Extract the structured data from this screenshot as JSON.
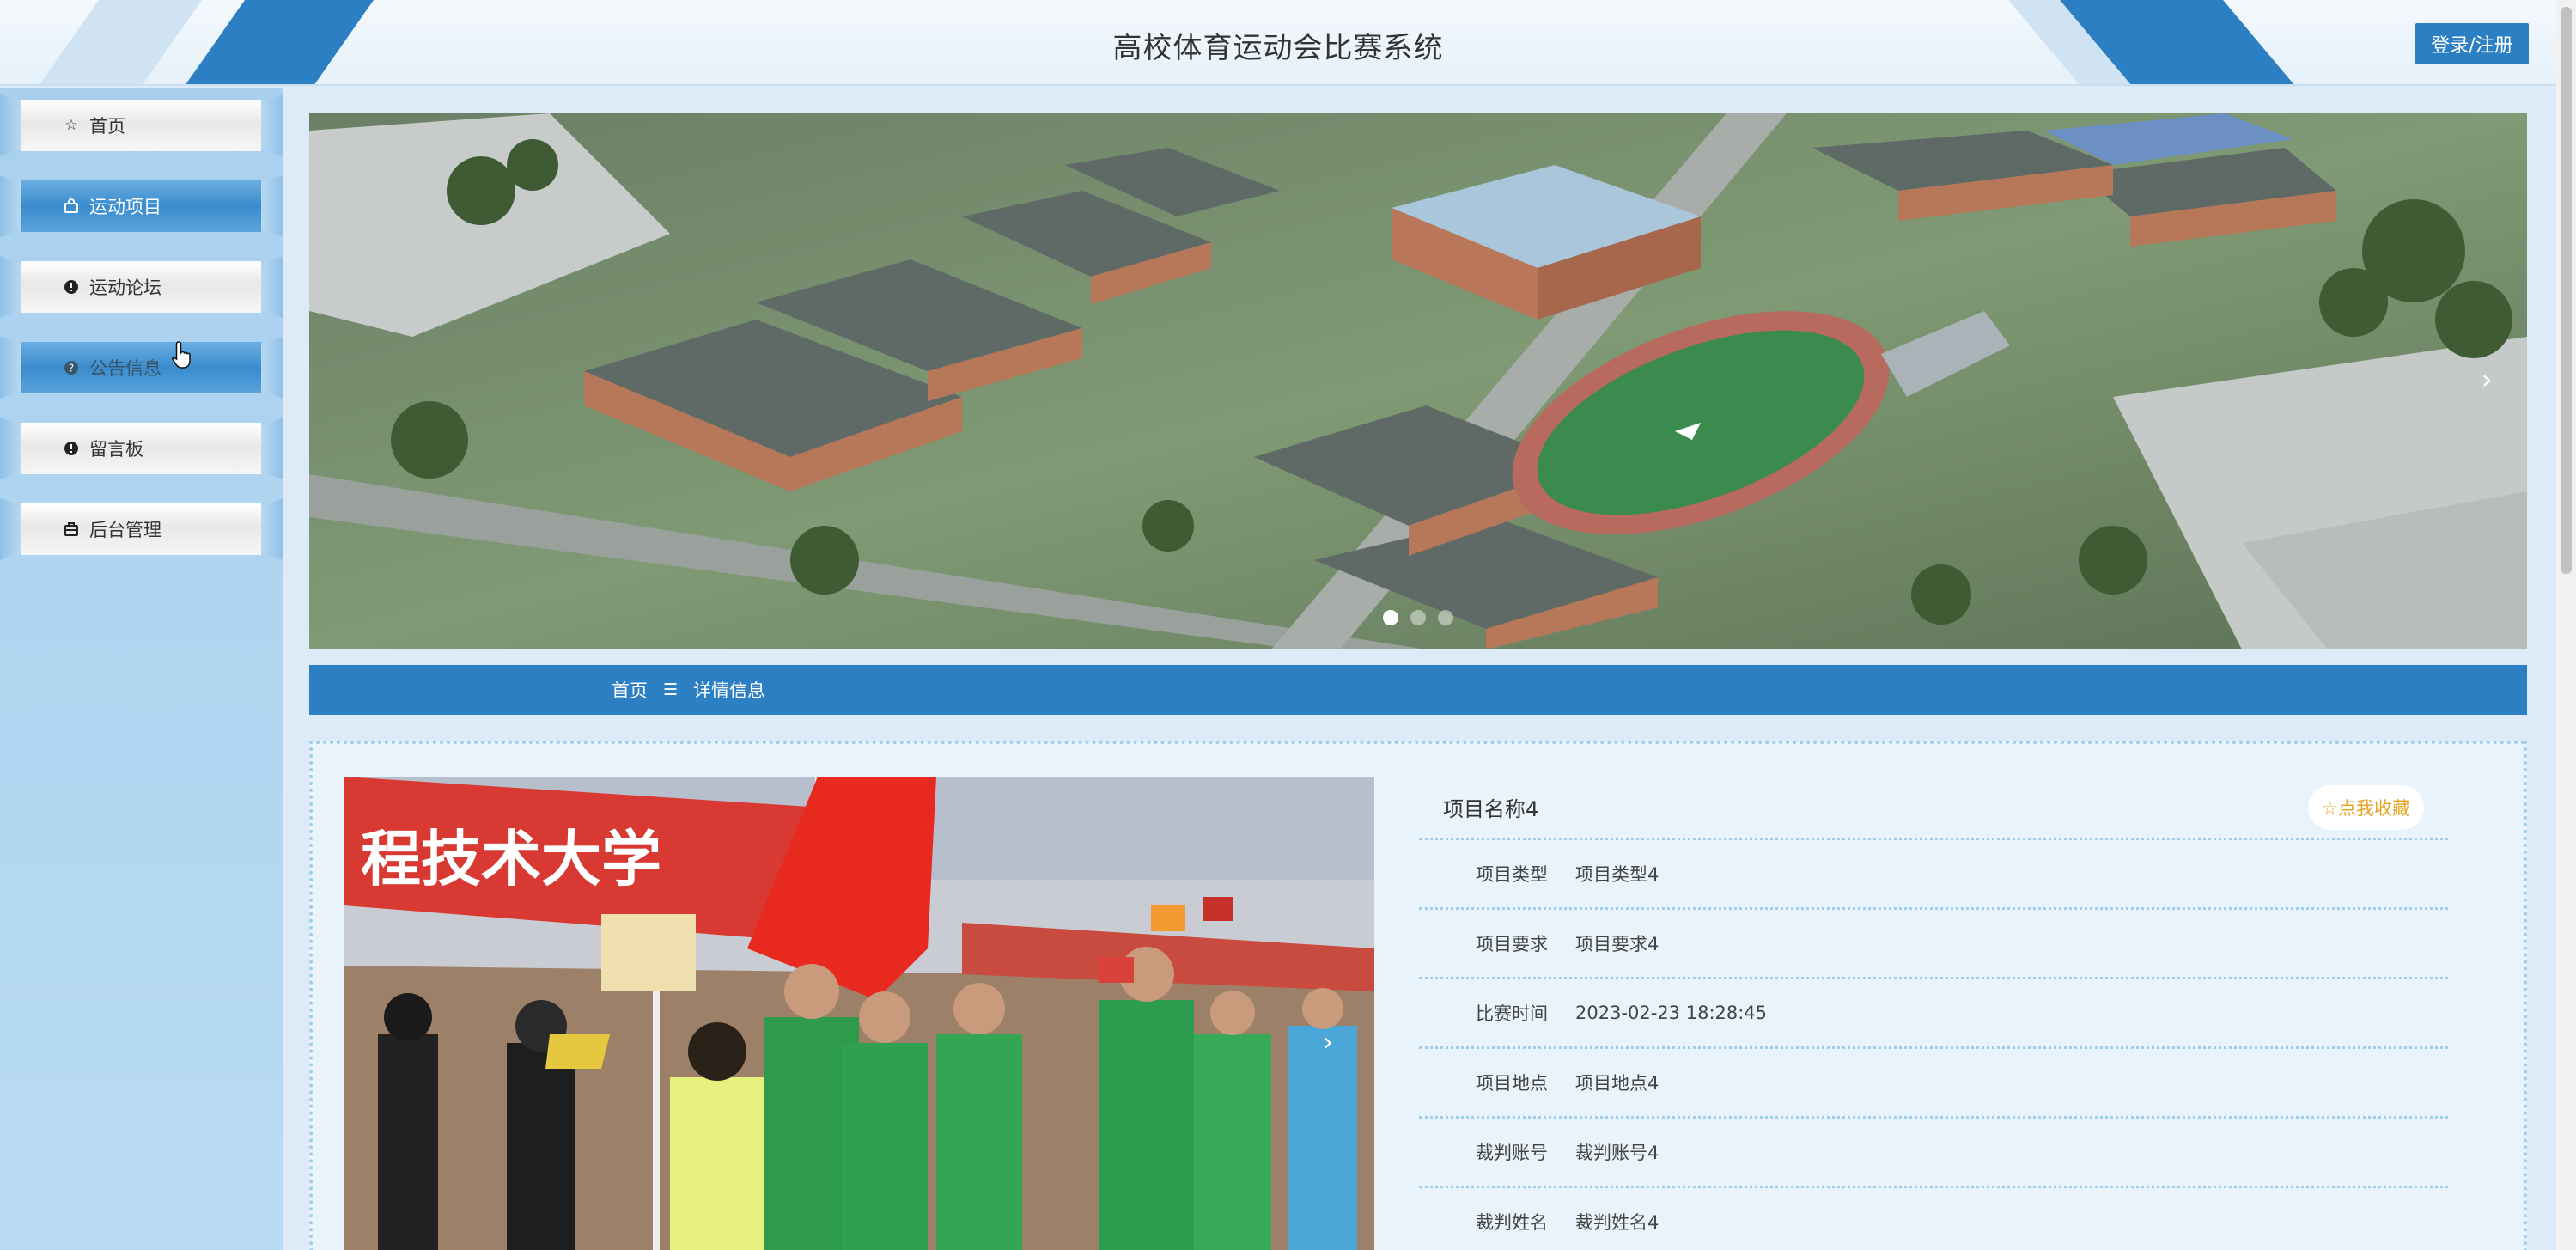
{
  "header": {
    "title": "高校体育运动会比赛系统",
    "login_label": "登录/注册"
  },
  "sidebar": {
    "items": [
      {
        "label": "首页",
        "icon": "star-icon",
        "active": false
      },
      {
        "label": "运动项目",
        "icon": "bag-icon",
        "active": true
      },
      {
        "label": "运动论坛",
        "icon": "info-circle-icon",
        "active": false
      },
      {
        "label": "公告信息",
        "icon": "question-circle-icon",
        "active": true
      },
      {
        "label": "留言板",
        "icon": "info-circle-icon",
        "active": false
      },
      {
        "label": "后台管理",
        "icon": "briefcase-icon",
        "active": false
      }
    ]
  },
  "banner": {
    "slide_count": 3,
    "active_slide": 1,
    "next_glyph": "›"
  },
  "breadcrumb": {
    "home": "首页",
    "separator": "☰",
    "current": "详情信息"
  },
  "detail": {
    "title": "项目名称4",
    "favorite_label": "☆点我收藏",
    "fields": [
      {
        "label": "项目类型",
        "value": "项目类型4"
      },
      {
        "label": "项目要求",
        "value": "项目要求4"
      },
      {
        "label": "比赛时间",
        "value": "2023-02-23 18:28:45"
      },
      {
        "label": "项目地点",
        "value": "项目地点4"
      },
      {
        "label": "裁判账号",
        "value": "裁判账号4"
      },
      {
        "label": "裁判姓名",
        "value": "裁判姓名4"
      }
    ],
    "photo_next_glyph": "›"
  },
  "colors": {
    "primary": "#2b7fc2",
    "sidebar_bg": "#a9d0ee",
    "favorite": "#e8a424"
  }
}
